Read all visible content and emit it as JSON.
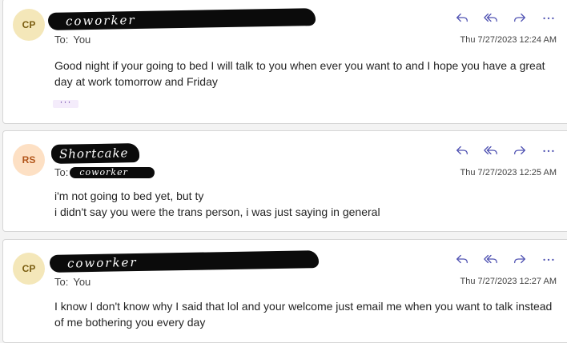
{
  "messages": [
    {
      "avatar_initials": "CP",
      "avatar_bg": "#f4e7b9",
      "avatar_fg": "#7a5d10",
      "sender": "coworker",
      "to_label": "To:",
      "to_value": "You",
      "timestamp": "Thu 7/27/2023 12:24 AM",
      "body_lines": [
        "Good night if your going to bed I will talk to you when ever you want to and I hope you have a great day at work tomorrow and Friday"
      ],
      "ellipsis": "···"
    },
    {
      "avatar_initials": "RS",
      "avatar_bg": "#fde0c4",
      "avatar_fg": "#b2551a",
      "sender": "Shortcake",
      "to_label": "To:",
      "to_value": "coworker",
      "timestamp": "Thu 7/27/2023 12:25 AM",
      "body_lines": [
        "i'm not going to bed yet, but ty",
        "i didn't say you were the trans person, i was just saying in general"
      ]
    },
    {
      "avatar_initials": "CP",
      "avatar_bg": "#f4e7b9",
      "avatar_fg": "#7a5d10",
      "sender": "coworker",
      "to_label": "To:",
      "to_value": "You",
      "timestamp": "Thu 7/27/2023 12:27 AM",
      "body_lines": [
        "I know I don't know why I said that lol and your welcome just email me when you want to talk instead of me bothering you every day"
      ]
    }
  ],
  "actions": [
    "reply-icon",
    "reply-all-icon",
    "forward-icon",
    "more-icon"
  ],
  "colors": {
    "icon": "#4f52b2"
  }
}
